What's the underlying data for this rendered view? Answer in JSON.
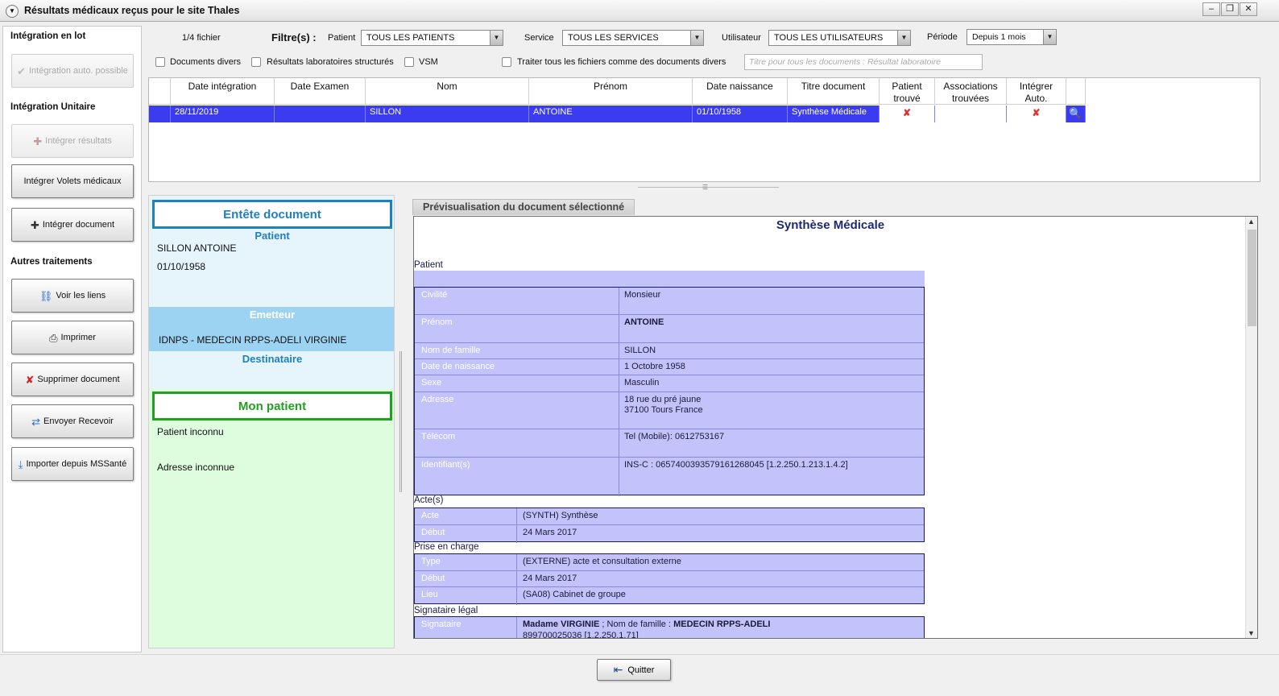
{
  "window": {
    "title": "Résultats médicaux reçus pour le site Thales"
  },
  "left": {
    "section_lot": "Intégration en lot",
    "btn_auto": "Intégration auto. possible",
    "section_unit": "Intégration Unitaire",
    "btn_integrer_resultats": "Intégrer résultats",
    "btn_volets": "Intégrer Volets médicaux",
    "btn_integrer_document": "Intégrer document",
    "section_autres": "Autres traitements",
    "btn_liens": "Voir les liens",
    "btn_imprimer": "Imprimer",
    "btn_supprimer": "Supprimer document",
    "btn_envoyer": "Envoyer Recevoir",
    "btn_mssante": "Importer depuis MSSanté"
  },
  "filters": {
    "file_count": "1/4 fichier",
    "label": "Filtre(s) :",
    "patient_label": "Patient",
    "patient_value": "TOUS LES PATIENTS",
    "service_label": "Service",
    "service_value": "TOUS LES SERVICES",
    "user_label": "Utilisateur",
    "user_value": "TOUS LES UTILISATEURS",
    "period_label": "Période",
    "period_value": "Depuis 1 mois",
    "chk_docs": "Documents divers",
    "chk_labo": "Résultats laboratoires structurés",
    "chk_vsm": "VSM",
    "chk_traiter": "Traiter tous les fichiers comme des documents divers",
    "title_placeholder": "Titre pour tous les documents : Résultat laboratoire"
  },
  "grid": {
    "headers": {
      "date_integration": "Date intégration",
      "date_examen": "Date Examen",
      "nom": "Nom",
      "prenom": "Prénom",
      "date_naissance": "Date naissance",
      "titre": "Titre document",
      "patient_trouve_1": "Patient",
      "patient_trouve_2": "trouvé",
      "assoc_1": "Associations",
      "assoc_2": "trouvées",
      "integrer_1": "Intégrer",
      "integrer_2": "Auto."
    },
    "row": {
      "date_integration": "28/11/2019",
      "date_examen": "",
      "nom": "SILLON",
      "prenom": "ANTOINE",
      "date_naissance": "01/10/1958",
      "titre": "Synthèse Médicale",
      "patient_trouve": "✘",
      "integrer_auto": "✘"
    }
  },
  "header_doc": {
    "title": "Entête document",
    "patient_label": "Patient",
    "patient_name": "SILLON ANTOINE",
    "patient_dob": "01/10/1958",
    "emetteur_label": "Emetteur",
    "emetteur_value": "IDNPS - MEDECIN RPPS-ADELI VIRGINIE",
    "destinataire_label": "Destinataire"
  },
  "mon_patient": {
    "title": "Mon patient",
    "line1": "Patient inconnu",
    "line2": "Adresse inconnue"
  },
  "preview": {
    "tab": "Prévisualisation du document sélectionné",
    "doc_title": "Synthèse Médicale",
    "sec_patient": "Patient",
    "patient_rows": [
      {
        "k": "Civilité",
        "v": "Monsieur"
      },
      {
        "k": "Prénom",
        "v": "ANTOINE"
      },
      {
        "k": "Nom de famille",
        "v": "SILLON"
      },
      {
        "k": "Date de naissance",
        "v": "1 Octobre 1958"
      },
      {
        "k": "Sexe",
        "v": "Masculin"
      },
      {
        "k": "Adresse",
        "v": "18 rue du pré jaune",
        "v2": "37100 Tours France"
      },
      {
        "k": "Télécom",
        "v": "Tel (Mobile): 0612753167"
      },
      {
        "k": "Identifiant(s)",
        "v": "INS-C : 0657400393579161268045 [1.2.250.1.213.1.4.2]"
      }
    ],
    "sec_actes": "Acte(s)",
    "actes_rows": [
      {
        "k": "Acte",
        "v": "(SYNTH) Synthèse"
      },
      {
        "k": "Début",
        "v": "24 Mars 2017"
      }
    ],
    "sec_prise": "Prise en charge",
    "prise_rows": [
      {
        "k": "Type",
        "v": "(EXTERNE) acte et consultation externe"
      },
      {
        "k": "Début",
        "v": "24 Mars 2017"
      },
      {
        "k": "Lieu",
        "v": "(SA08) Cabinet de groupe"
      }
    ],
    "sec_signataire": "Signataire légal",
    "signataire": {
      "k": "Signataire",
      "v_bold1": "Madame VIRGINIE",
      "v_mid": " ; Nom de famille : ",
      "v_bold2": "MEDECIN RPPS-ADELI",
      "v2": "899700025036 [1.2.250.1.71]"
    }
  },
  "bottom": {
    "quit": "Quitter"
  },
  "colors": {
    "selection": "#3b3bf0",
    "table_bg": "#c3c3fb",
    "entete_border": "#1f7fc0",
    "patient_green": "#22a022",
    "green_bg": "#ddfdde"
  }
}
